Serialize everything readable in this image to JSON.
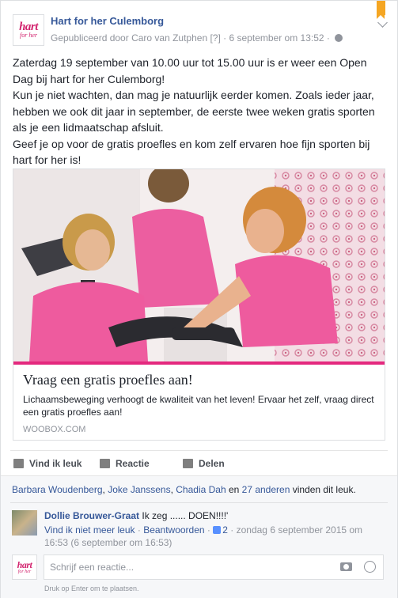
{
  "post": {
    "page_name": "Hart for her Culemborg",
    "published_by": "Gepubliceerd door Caro van Zutphen",
    "help_marker": "[?]",
    "separator": "·",
    "date": "6 september om 13:52",
    "logo_main": "hart",
    "logo_sub": "for her",
    "paragraphs": [
      "Zaterdag 19 september van 10.00 uur tot 15.00 uur is er weer een Open Dag bij hart for her Culemborg!",
      "Kun je niet wachten, dan mag je natuurlijk eerder komen. Zoals ieder jaar, hebben we ook dit jaar in september, de eerste twee weken gratis sporten als je een lidmaatschap afsluit.",
      "Geef je op voor de gratis proefles en kom zelf ervaren hoe fijn sporten bij hart for her is!"
    ]
  },
  "link_card": {
    "title": "Vraag een gratis proefles aan!",
    "description": "Lichaamsbeweging verhoogt de kwaliteit van het leven! Ervaar het zelf, vraag direct een gratis proefles aan!",
    "domain": "WOOBOX.COM"
  },
  "actions": {
    "like": "Vind ik leuk",
    "comment": "Reactie",
    "share": "Delen"
  },
  "likes": {
    "name1": "Barbara Woudenberg",
    "sep1": ", ",
    "name2": "Joke Janssens",
    "sep2": ", ",
    "name3": "Chadia Dah",
    "and": " en ",
    "others": "27 anderen",
    "suffix": " vinden dit leuk."
  },
  "comment": {
    "author": "Dollie Brouwer-Graat",
    "text": " Ik zeg ...... DOEN!!!!'",
    "unlike": "Vind ik niet meer leuk",
    "dot": " · ",
    "reply": "Beantwoorden",
    "like_count": "2",
    "timestamp": "zondag 6 september 2015 om 16:53 (6 september om 16:53)"
  },
  "reply": {
    "placeholder": "Schrijf een reactie...",
    "hint": "Druk op Enter om te plaatsen."
  },
  "colors": {
    "link_blue": "#365899",
    "brand_pink": "#d2236e",
    "accent_bar": "#e4287e",
    "bookmark": "#f5a623"
  }
}
